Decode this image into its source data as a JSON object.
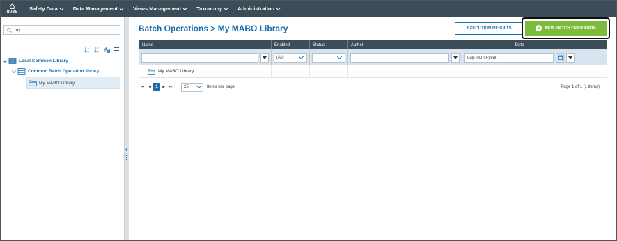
{
  "nav": {
    "home_label": "HOME",
    "items": [
      {
        "label": "Safety Data"
      },
      {
        "label": "Data Management"
      },
      {
        "label": "Views Management"
      },
      {
        "label": "Taxonomy"
      },
      {
        "label": "Administration"
      }
    ]
  },
  "sidebar": {
    "search_value": "my",
    "tree": [
      {
        "label": "Local Common Library"
      },
      {
        "label": "Common Batch Operation library"
      },
      {
        "label": "My MABO Library"
      }
    ]
  },
  "main": {
    "title": "Batch Operations > My MABO Library",
    "execution_results_label": "EXECUTION RESULTS",
    "new_batch_label": "NEW BATCH OPERATION"
  },
  "grid": {
    "columns": [
      "Name",
      "Enabled",
      "Status",
      "Author",
      "Date"
    ],
    "filters": {
      "enabled_value": "(All)",
      "status_value": "",
      "date_placeholder": "day-month-year"
    },
    "rows": [
      {
        "name": "My MABO Library"
      }
    ]
  },
  "pager": {
    "current_page": "1",
    "page_size": "25",
    "items_per_page_label": "Items per page",
    "page_info": "Page 1 of 1 (1 items)"
  },
  "colors": {
    "nav_bg": "#3b4d58",
    "accent": "#1a6fb0",
    "new_button": "#7dbb3c"
  }
}
